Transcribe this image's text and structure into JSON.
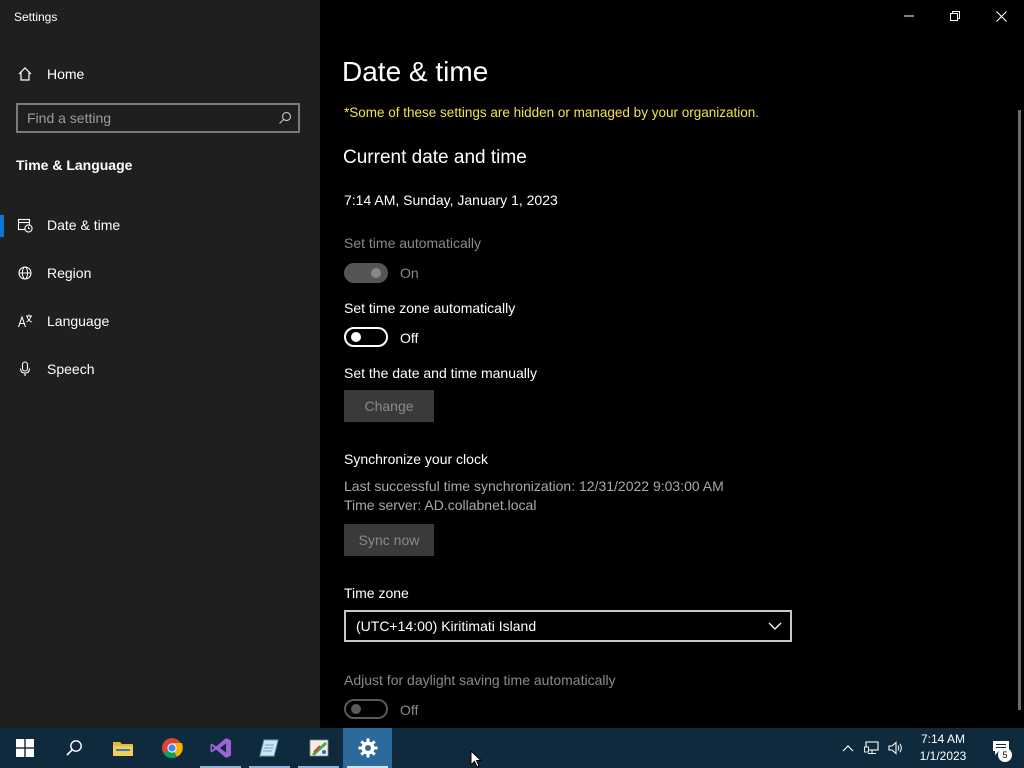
{
  "window": {
    "title": "Settings"
  },
  "sidebar": {
    "home_label": "Home",
    "search_placeholder": "Find a setting",
    "section_title": "Time & Language",
    "items": [
      {
        "label": "Date & time",
        "icon": "clock-calendar-icon",
        "active": true
      },
      {
        "label": "Region",
        "icon": "globe-icon",
        "active": false
      },
      {
        "label": "Language",
        "icon": "language-icon",
        "active": false
      },
      {
        "label": "Speech",
        "icon": "microphone-icon",
        "active": false
      }
    ]
  },
  "main": {
    "title": "Date & time",
    "org_notice": "*Some of these settings are hidden or managed by your organization.",
    "current_heading": "Current date and time",
    "current_value": "7:14 AM, Sunday, January 1, 2023",
    "set_time_auto": {
      "label": "Set time automatically",
      "state": "On",
      "enabled": false
    },
    "set_tz_auto": {
      "label": "Set time zone automatically",
      "state": "Off",
      "enabled": true
    },
    "manual": {
      "label": "Set the date and time manually",
      "button": "Change"
    },
    "sync": {
      "heading": "Synchronize your clock",
      "last_sync": "Last successful time synchronization: 12/31/2022 9:03:00 AM",
      "server": "Time server: AD.collabnet.local",
      "button": "Sync now"
    },
    "timezone": {
      "label": "Time zone",
      "value": "(UTC+14:00) Kiritimati Island"
    },
    "dst": {
      "label": "Adjust for daylight saving time automatically",
      "state": "Off",
      "enabled": false
    }
  },
  "taskbar": {
    "apps": [
      "start-icon",
      "search-icon",
      "file-explorer-icon",
      "chrome-icon",
      "visual-studio-icon",
      "notepad-app-icon",
      "paint-app-icon",
      "settings-gear-icon"
    ],
    "clock_time": "7:14 AM",
    "clock_date": "1/1/2023",
    "notification_count": "5"
  },
  "colors": {
    "accent": "#0a78d7",
    "notice": "#f2e34c",
    "sidebar_bg": "#1f1f1f",
    "taskbar_bg": "#0e2a3c"
  }
}
